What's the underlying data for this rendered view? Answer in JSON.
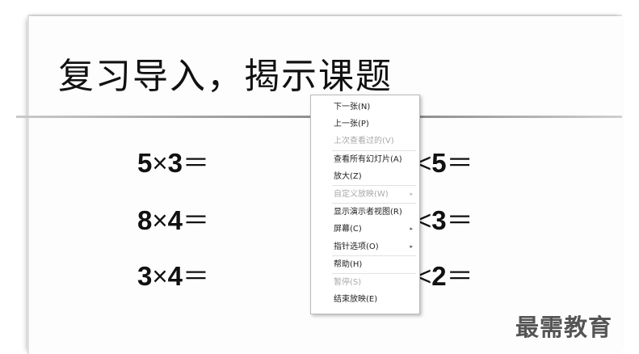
{
  "slide": {
    "title": "复习导入，揭示课题",
    "left_column": [
      {
        "a": "5",
        "op": "×",
        "b": "3",
        "eq": "＝"
      },
      {
        "a": "8",
        "op": "×",
        "b": "4",
        "eq": "＝"
      },
      {
        "a": "3",
        "op": "×",
        "b": "4",
        "eq": "＝"
      }
    ],
    "right_column": [
      {
        "op": "<",
        "b": "5",
        "eq": "＝"
      },
      {
        "op": "<",
        "b": "3",
        "eq": "＝"
      },
      {
        "op": "<",
        "b": "2",
        "eq": "＝"
      }
    ]
  },
  "context_menu": {
    "items": [
      {
        "label": "下一张(N)",
        "disabled": false
      },
      {
        "label": "上一张(P)",
        "disabled": false
      },
      {
        "label": "上次查看过的(V)",
        "disabled": true
      },
      {
        "label": "查看所有幻灯片(A)",
        "disabled": false
      },
      {
        "label": "放大(Z)",
        "disabled": false
      },
      {
        "label": "自定义放映(W)",
        "disabled": true,
        "submenu": true
      },
      {
        "label": "显示演示者视图(R)",
        "disabled": false
      },
      {
        "label": "屏幕(C)",
        "disabled": false,
        "submenu": true
      },
      {
        "label": "指针选项(O)",
        "disabled": false,
        "submenu": true
      },
      {
        "label": "帮助(H)",
        "disabled": false
      },
      {
        "label": "暂停(S)",
        "disabled": true
      },
      {
        "label": "结束放映(E)",
        "disabled": false
      }
    ],
    "submenu_arrow": "▸"
  },
  "watermark": "最需教育"
}
